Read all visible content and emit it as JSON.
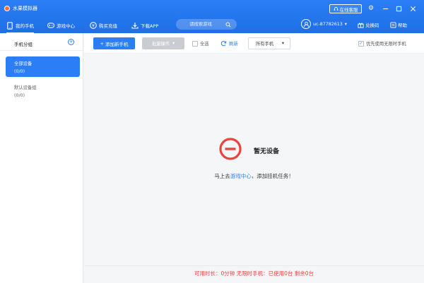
{
  "titlebar": {
    "app_title": "水果模拟器",
    "support_label": "在线客服"
  },
  "nav": {
    "items": [
      {
        "label": "我的手机"
      },
      {
        "label": "游戏中心"
      },
      {
        "label": "购买充值"
      },
      {
        "label": "下载APP"
      }
    ],
    "search_placeholder": "请搜索游戏",
    "user_id": "uc-87782613",
    "redeem_label": "兑换码",
    "help_label": "帮助"
  },
  "sidebar": {
    "title": "手机分组",
    "groups": [
      {
        "name": "全部设备",
        "count": "(0/0)"
      },
      {
        "name": "默认设备组",
        "count": "(0/0)"
      }
    ]
  },
  "toolbar": {
    "add_label": "添加新手机",
    "batch_label": "批量操作",
    "select_all_label": "全选",
    "refresh_label": "刷新",
    "filter_selected": "所有手机",
    "prefer_label": "优先使用无限时手机"
  },
  "empty": {
    "title": "暂无设备",
    "sub_prefix": "马上去",
    "sub_link": "游戏中心",
    "sub_suffix": "，添加挂机任务！"
  },
  "footer": {
    "status": "可用时长：0分钟 无限时手机：已使用0台 剩余0台"
  },
  "colors": {
    "accent": "#2b7ef6",
    "danger": "#e8453c"
  }
}
